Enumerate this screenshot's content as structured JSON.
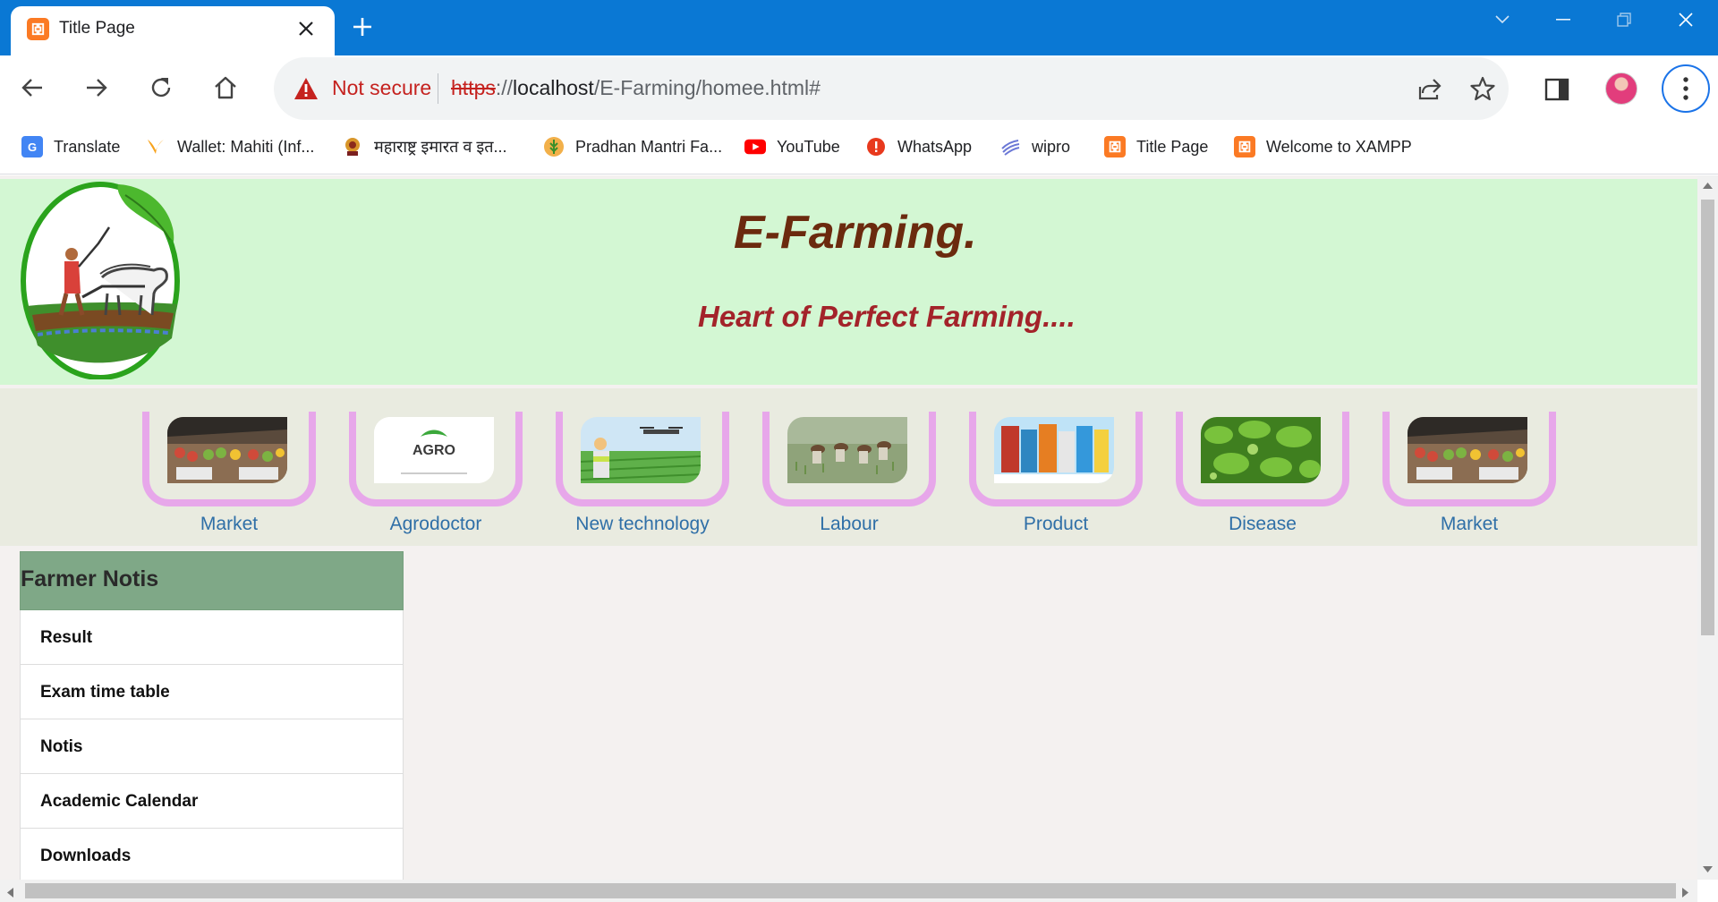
{
  "tab": {
    "title": "Title Page"
  },
  "toolbar": {
    "not_secure": "Not secure",
    "url_scheme": "https",
    "url_rest_sep": "://",
    "url_host": "localhost",
    "url_path": "/E-Farming/homee.html#"
  },
  "bookmarks": [
    {
      "label": "Translate",
      "icon": "google-translate-icon"
    },
    {
      "label": "Wallet: Mahiti (Inf...",
      "icon": "wallet-icon"
    },
    {
      "label": "महाराष्ट्र इमारत व इत...",
      "icon": "emblem-icon"
    },
    {
      "label": "Pradhan Mantri Fa...",
      "icon": "pmfby-icon"
    },
    {
      "label": "YouTube",
      "icon": "youtube-icon"
    },
    {
      "label": "WhatsApp",
      "icon": "whatsapp-icon"
    },
    {
      "label": "wipro",
      "icon": "wipro-icon"
    },
    {
      "label": "Title Page",
      "icon": "xampp-icon"
    },
    {
      "label": "Welcome to XAMPP",
      "icon": "xampp-icon"
    }
  ],
  "site": {
    "title": "E-Farming.",
    "tagline": "Heart of Perfect Farming...."
  },
  "nav_cards": [
    {
      "label": "Market",
      "image": "market-vegetables"
    },
    {
      "label": "Agrodoctor",
      "image": "agro-logo"
    },
    {
      "label": "New technology",
      "image": "drone-field"
    },
    {
      "label": "Labour",
      "image": "paddy-workers"
    },
    {
      "label": "Product",
      "image": "fertilizer-packs"
    },
    {
      "label": "Disease",
      "image": "leaf-disease"
    },
    {
      "label": "Market",
      "image": "market-vegetables"
    }
  ],
  "agro_logo_text": "AGRO",
  "sidebar": {
    "heading": "Farmer Notis",
    "items": [
      "Result",
      "Exam time table",
      "Notis",
      "Academic Calendar",
      "Downloads"
    ]
  },
  "colors": {
    "tabstrip": "#0a78d4",
    "header_bg": "#d3f7d3",
    "title": "#6b2a0e",
    "tagline": "#a3232a",
    "card_frame": "#e7a7ea",
    "card_label": "#2f6fa7",
    "sidebar_head": "#7fa887"
  }
}
